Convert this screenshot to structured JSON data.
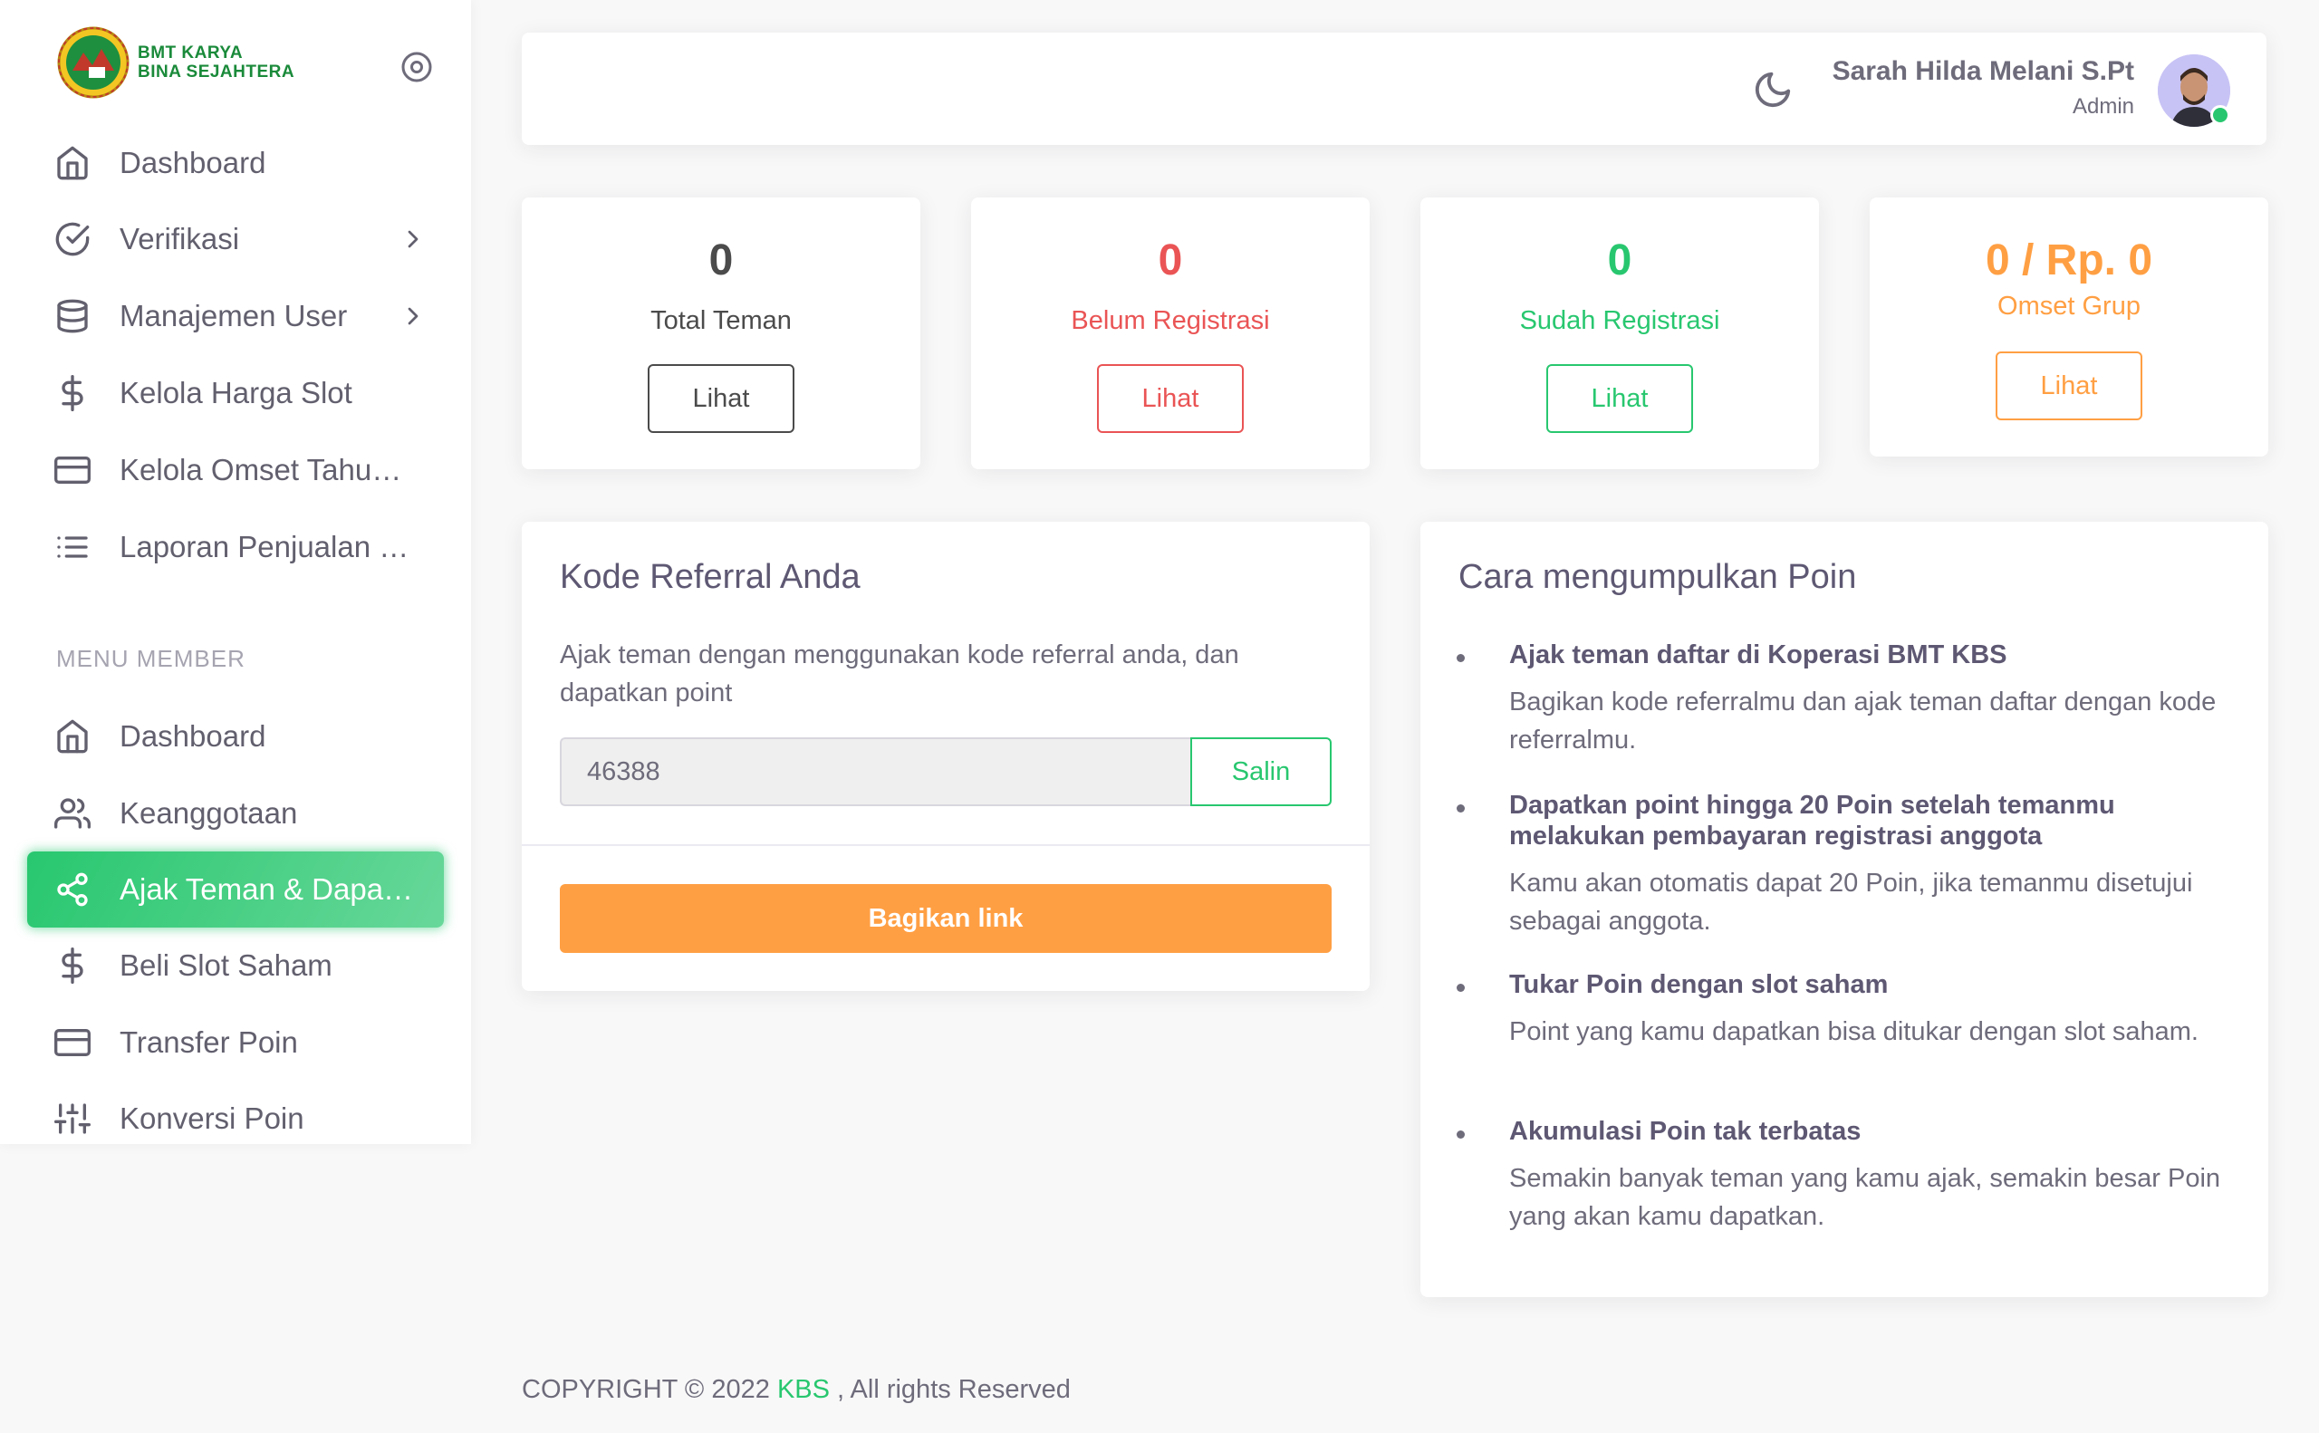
{
  "sidebar": {
    "brand": {
      "line1": "BMT KARYA",
      "line2": "BINA SEJAHTERA"
    },
    "items": [
      {
        "label": "Dashboard",
        "icon": "home-icon"
      },
      {
        "label": "Verifikasi",
        "icon": "check-circle-icon",
        "has_children": true
      },
      {
        "label": "Manajemen User",
        "icon": "database-icon",
        "has_children": true
      },
      {
        "label": "Kelola Harga Slot",
        "icon": "dollar-icon"
      },
      {
        "label": "Kelola Omset Tahu…",
        "icon": "credit-card-icon"
      },
      {
        "label": "Laporan Penjualan …",
        "icon": "list-icon"
      }
    ],
    "section_header": "MENU MEMBER",
    "member_items": [
      {
        "label": "Dashboard",
        "icon": "home-icon"
      },
      {
        "label": "Keanggotaan",
        "icon": "users-icon"
      },
      {
        "label": "Ajak Teman & Dapa…",
        "icon": "share-icon",
        "active": true
      },
      {
        "label": "Beli Slot Saham",
        "icon": "dollar-icon"
      },
      {
        "label": "Transfer Poin",
        "icon": "credit-card-icon"
      },
      {
        "label": "Konversi Poin",
        "icon": "sliders-icon"
      }
    ]
  },
  "navbar": {
    "user_name": "Sarah Hilda Melani S.Pt",
    "user_role": "Admin"
  },
  "stats": [
    {
      "value": "0",
      "caption": "Total Teman",
      "button": "Lihat",
      "color": "#4b4b4b"
    },
    {
      "value": "0",
      "caption": "Belum Registrasi",
      "button": "Lihat",
      "color": "#ea5455"
    },
    {
      "value": "0",
      "caption": "Sudah Registrasi",
      "button": "Lihat",
      "color": "#28c76f"
    },
    {
      "value": "0 / Rp. 0",
      "caption": "Omset Grup",
      "button": "Lihat",
      "color": "#ff9f43"
    }
  ],
  "referral": {
    "title": "Kode Referral Anda",
    "description": "Ajak teman dengan menggunakan kode referral anda, dan dapatkan point",
    "code": "46388",
    "copy_label": "Salin",
    "share_label": "Bagikan link"
  },
  "poin": {
    "title": "Cara mengumpulkan Poin",
    "tips": [
      {
        "title": "Ajak teman daftar di Koperasi BMT KBS",
        "desc": "Bagikan kode referralmu dan ajak teman daftar dengan kode referralmu."
      },
      {
        "title": "Dapatkan point hingga 20 Poin setelah temanmu melakukan pembayaran registrasi anggota",
        "desc": "Kamu akan otomatis dapat 20 Poin, jika temanmu disetujui sebagai anggota."
      },
      {
        "title": "Tukar Poin dengan slot saham",
        "desc": "Point yang kamu dapatkan bisa ditukar dengan slot saham."
      },
      {
        "title": "Akumulasi Poin tak terbatas",
        "desc": "Semakin banyak teman yang kamu ajak, semakin besar Poin yang akan kamu dapatkan."
      }
    ]
  },
  "footer": {
    "prefix": "COPYRIGHT © 2022",
    "brand": "KBS",
    "suffix": ", All rights Reserved"
  },
  "colors": {
    "primary": "#28c76f",
    "danger": "#ea5455",
    "warning": "#ff9f43",
    "dark": "#4b4b4b"
  }
}
